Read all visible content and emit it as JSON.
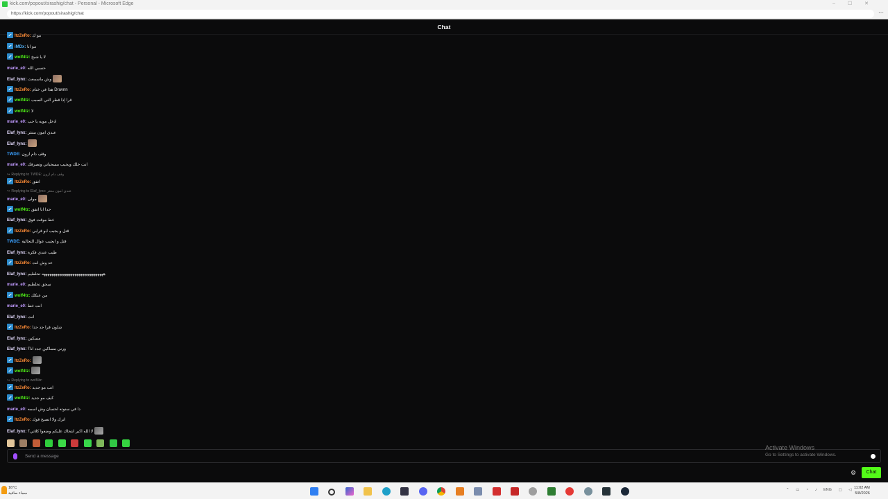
{
  "browser": {
    "title": "kick.com/popout/sirashig/chat - Personal - Microsoft Edge",
    "url": "https://kick.com/popout/sirashig/chat"
  },
  "header": {
    "title": "Chat"
  },
  "colors": {
    "ItzZeRo": "#ff8c36",
    "wolf4tz": "#53fc18",
    "marie_e0": "#c19bff",
    "Elaf_lynx": "#e5dcff",
    "iMDx": "#52b6ff",
    "TWDE": "#3aa0ff"
  },
  "messages": [
    {
      "user": "ItzZeRo",
      "badge": true,
      "text": "مو ك"
    },
    {
      "user": "iMDx",
      "badge": true,
      "text": "مو انا"
    },
    {
      "user": "wolf4tz",
      "badge": true,
      "text": "لا يا شيخ"
    },
    {
      "user": "marie_e0",
      "badge": false,
      "text": "حسبي الله"
    },
    {
      "user": "Elaf_lynx",
      "badge": false,
      "text": "وش ماسمعت",
      "emote": true
    },
    {
      "user": "ItzZeRo",
      "badge": true,
      "text": "هذا في ختام Dravnn"
    },
    {
      "user": "wolf4tz",
      "badge": true,
      "text": "قرا إذا قطر الني السبب"
    },
    {
      "user": "wolf4tz",
      "badge": true,
      "text": "لا"
    },
    {
      "user": "marie_e0",
      "badge": false,
      "text": "ادخل مويه يا حب"
    },
    {
      "user": "Elaf_lynx",
      "badge": false,
      "text": "عندي امون منتثر"
    },
    {
      "user": "Elaf_lynx",
      "badge": false,
      "text": "",
      "emote": true
    },
    {
      "user": "TWDE",
      "badge": false,
      "text": "وقف دام ازون"
    },
    {
      "user": "marie_e0",
      "badge": false,
      "text": "انت خلك ويجيب مسحباتي وتصرفك"
    },
    {
      "reply": "Replying to TWDE: وقف دام ازون"
    },
    {
      "user": "ItzZeRo",
      "badge": true,
      "text": "اتفق"
    },
    {
      "reply": "Replying to Elaf_lynx: عندي امون منتثر"
    },
    {
      "user": "marie_e0",
      "badge": false,
      "text": "مولى",
      "emote": true
    },
    {
      "user": "wolf4tz",
      "badge": true,
      "text": "حدا انا اتفق"
    },
    {
      "user": "Elaf_lynx",
      "badge": false,
      "text": "خط موقت فوق"
    },
    {
      "user": "ItzZeRo",
      "badge": true,
      "text": "قتل و يجيب ابو قرابي"
    },
    {
      "user": "TWDE",
      "badge": false,
      "text": "قتل و ابجيب عوال التحالية"
    },
    {
      "user": "Elaf_lynx",
      "badge": false,
      "text": "طيب عندي فكرة"
    },
    {
      "user": "ItzZeRo",
      "badge": true,
      "text": "عد وش انت"
    },
    {
      "user": "Elaf_lynx",
      "badge": false,
      "text": "ههههههههههههههههههههههههههههههههه تحلطيم"
    },
    {
      "user": "marie_e0",
      "badge": false,
      "text": "سحق تحلطيم"
    },
    {
      "user": "wolf4tz",
      "badge": true,
      "text": "من عنكك"
    },
    {
      "user": "marie_e0",
      "badge": false,
      "text": "انت خط"
    },
    {
      "user": "Elaf_lynx",
      "badge": false,
      "text": "انت"
    },
    {
      "user": "ItzZeRo",
      "badge": true,
      "text": "شلون قرا جد حدا"
    },
    {
      "user": "Elaf_lynx",
      "badge": false,
      "text": "مسكين"
    },
    {
      "user": "Elaf_lynx",
      "badge": false,
      "text": "ورني مساكين جدد انا؟"
    },
    {
      "user": "ItzZeRo",
      "badge": true,
      "text": "",
      "emote": true,
      "emote_style": "gray"
    },
    {
      "user": "wolf4tz",
      "badge": true,
      "text": "",
      "emote": true,
      "emote_style": "gray"
    },
    {
      "reply": "Replying to wolf4tz:"
    },
    {
      "user": "ItzZeRo",
      "badge": true,
      "text": "انت مو جديد"
    },
    {
      "user": "wolf4tz",
      "badge": true,
      "text": "كيف مو جديد"
    },
    {
      "user": "marie_e0",
      "badge": false,
      "text": "دا في سنوته لحسان وش اسمه"
    },
    {
      "user": "ItzZeRo",
      "badge": true,
      "text": "اترك ولا اتصبح فوك"
    },
    {
      "user": "Elaf_lynx",
      "badge": false,
      "text": "لا الله اكبر انتحاك عليكم وضعوا كلاتي؟",
      "emote": true,
      "emote_style": "gray"
    }
  ],
  "input": {
    "placeholder": "Send a message"
  },
  "activation": {
    "title": "Activate Windows",
    "subtitle": "Go to Settings to activate Windows."
  },
  "chat_button": "Chat",
  "taskbar": {
    "weather_temp": "16°C",
    "weather_desc": "سماء صافية",
    "lang": "ENG",
    "time": "11:02 AM",
    "date": "5/8/2026"
  }
}
